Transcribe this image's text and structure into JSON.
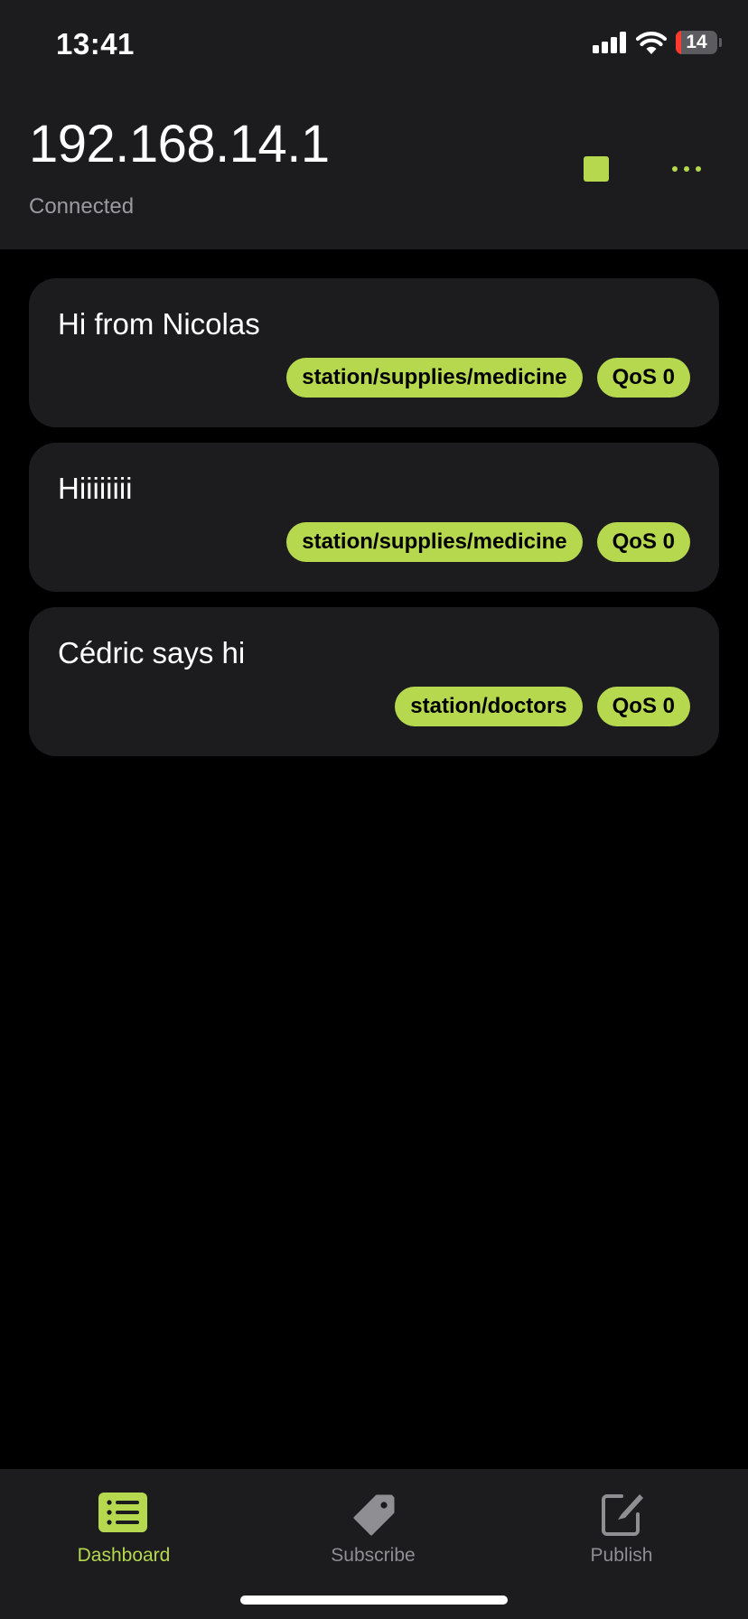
{
  "status_bar": {
    "time": "13:41",
    "battery_level": "14",
    "battery_fraction": 0.14,
    "icons": [
      "cellular-signal-icon",
      "wifi-icon",
      "battery-icon"
    ]
  },
  "header": {
    "title": "192.168.14.1",
    "subtitle": "Connected",
    "icons": [
      "stop-icon",
      "more-icon"
    ]
  },
  "messages": [
    {
      "text": "Hi from Nicolas",
      "topic": "station/supplies/medicine",
      "qos": "QoS 0"
    },
    {
      "text": "Hiiiiiiii",
      "topic": "station/supplies/medicine",
      "qos": "QoS 0"
    },
    {
      "text": "Cédric says hi",
      "topic": "station/doctors",
      "qos": "QoS 0"
    }
  ],
  "tab_bar": {
    "tabs": [
      {
        "label": "Dashboard",
        "icon": "list-icon",
        "active": true
      },
      {
        "label": "Subscribe",
        "icon": "tag-icon",
        "active": false
      },
      {
        "label": "Publish",
        "icon": "compose-icon",
        "active": false
      }
    ]
  },
  "colors": {
    "accent": "#b5d84f",
    "background": "#000000",
    "surface": "#1c1c1e",
    "secondary_text": "#9a9aa0",
    "inactive_tab": "#8e8e93",
    "battery_low": "#ff3b30"
  }
}
